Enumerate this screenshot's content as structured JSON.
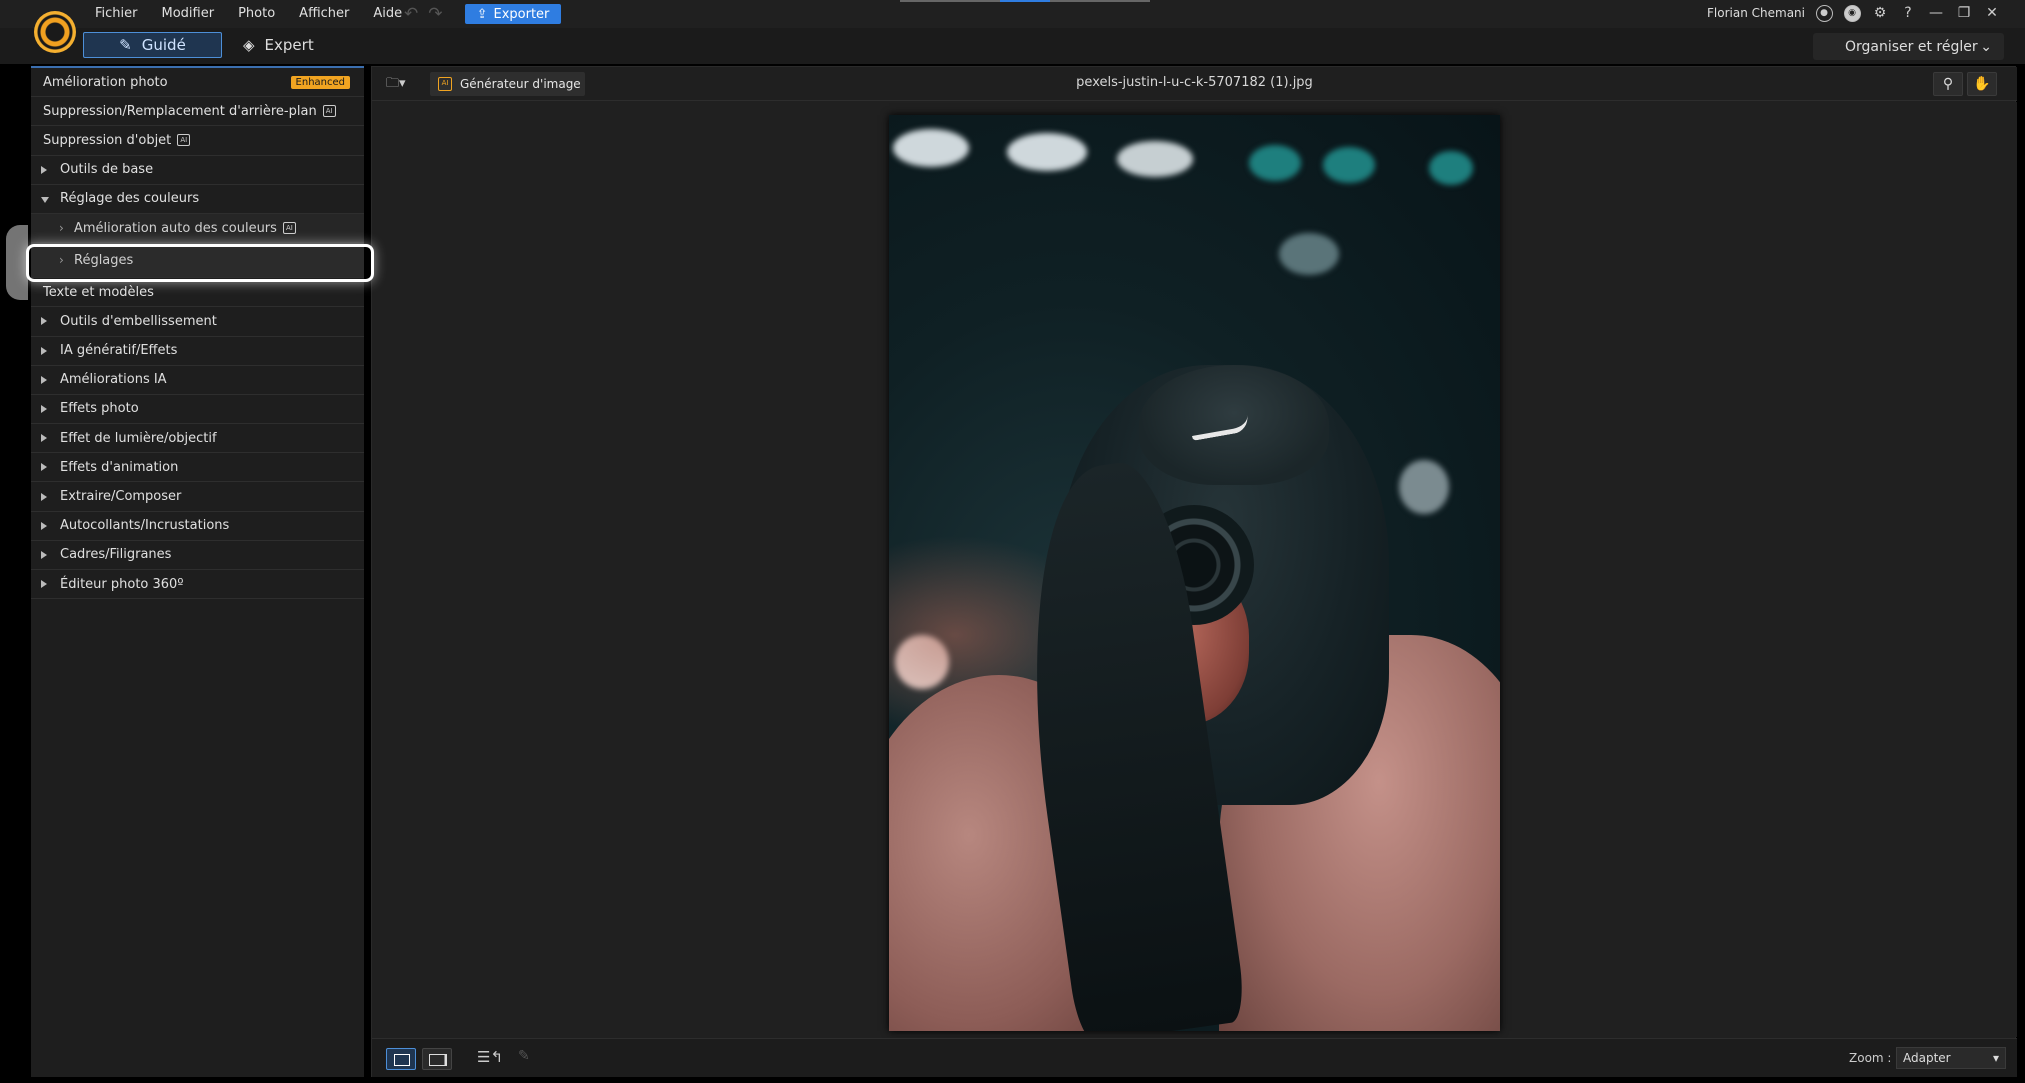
{
  "menu": [
    "Fichier",
    "Modifier",
    "Photo",
    "Afficher",
    "Aide"
  ],
  "export_label": "Exporter",
  "user": {
    "name": "Florian Chemani"
  },
  "modes": {
    "guided": "Guidé",
    "expert": "Expert"
  },
  "organise_label": "Organiser et régler",
  "sidebar": {
    "items": [
      {
        "label": "Amélioration photo",
        "badge": "Enhanced"
      },
      {
        "label": "Suppression/Remplacement d'arrière-plan"
      },
      {
        "label": "Suppression d'objet"
      },
      {
        "label": "Outils de base"
      },
      {
        "label": "Réglage des couleurs"
      },
      {
        "label": "Amélioration auto des couleurs"
      },
      {
        "label": "Réglages"
      },
      {
        "label": "Texte et modèles"
      },
      {
        "label": "Outils d'embellissement"
      },
      {
        "label": "IA génératif/Effets"
      },
      {
        "label": "Améliorations IA"
      },
      {
        "label": "Effets photo"
      },
      {
        "label": "Effet de lumière/objectif"
      },
      {
        "label": "Effets d'animation"
      },
      {
        "label": "Extraire/Composer"
      },
      {
        "label": "Autocollants/Incrustations"
      },
      {
        "label": "Cadres/Filigranes"
      },
      {
        "label": "Éditeur photo 360º"
      }
    ]
  },
  "toolbar": {
    "generator_label": "Générateur d'image",
    "filename": "pexels-justin-l-u-c-k-5707182 (1).jpg"
  },
  "bottom": {
    "zoom_label": "Zoom :",
    "zoom_value": "Adapter"
  },
  "colors": {
    "accent": "#2f7de1",
    "badge": "#f1a421"
  }
}
